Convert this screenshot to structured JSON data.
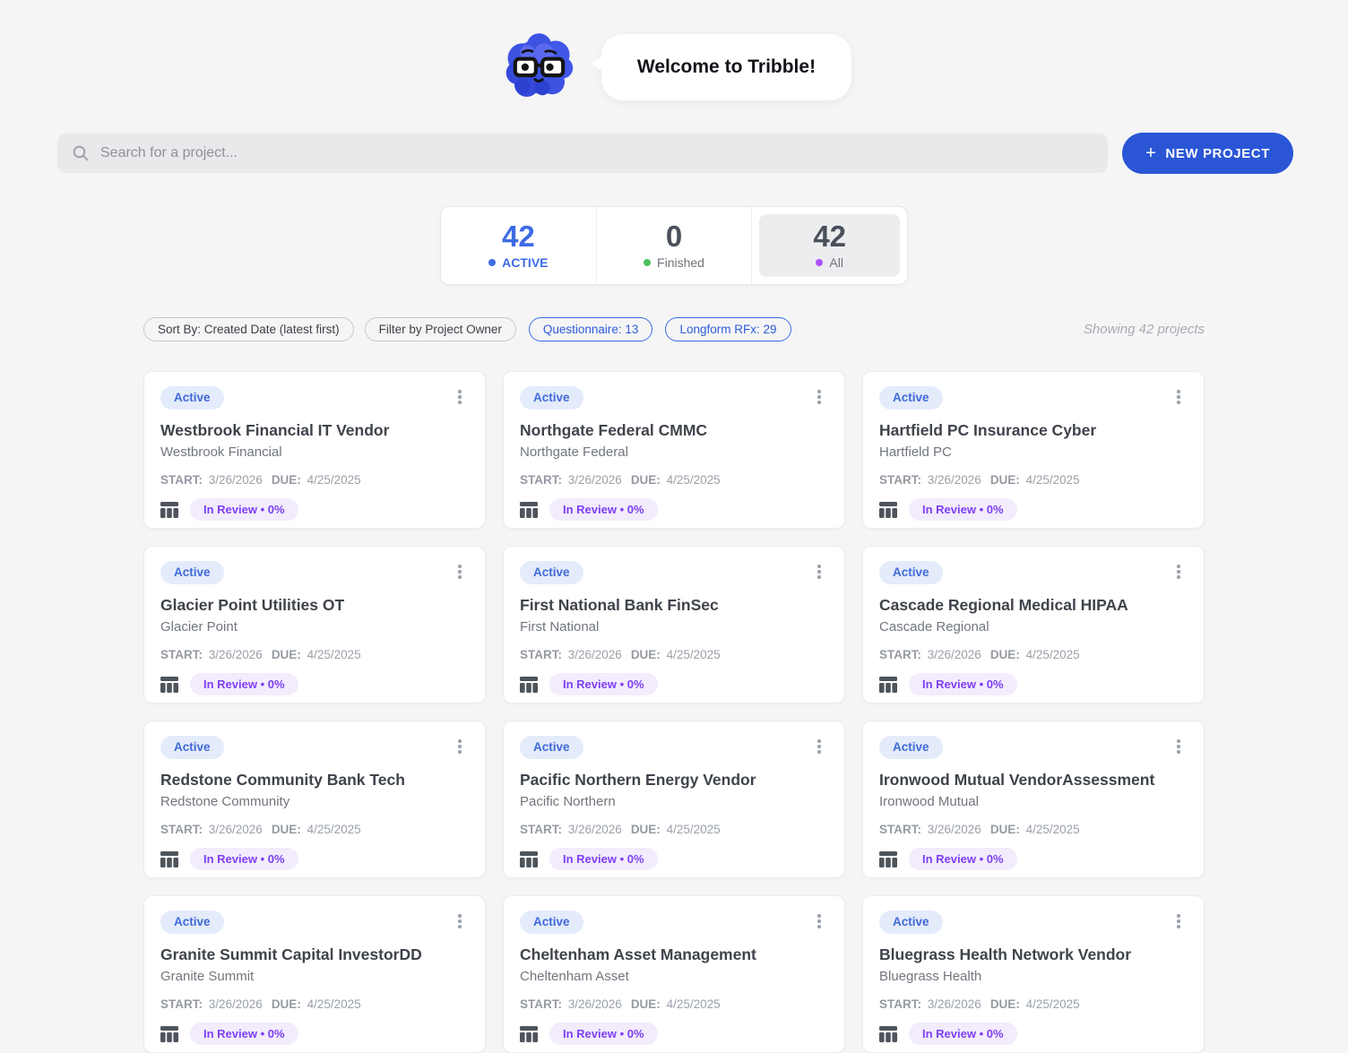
{
  "header": {
    "welcome_text": "Welcome to Tribble!"
  },
  "search": {
    "placeholder": "Search for a project..."
  },
  "toolbar": {
    "new_project_label": "NEW PROJECT",
    "plus_icon": "+"
  },
  "stats": {
    "items": [
      {
        "value": "42",
        "label": "ACTIVE",
        "dot_color": "#3e6be4",
        "highlighted": false
      },
      {
        "value": "0",
        "label": "Finished",
        "dot_color": "#4cc05e",
        "highlighted": false
      },
      {
        "value": "42",
        "label": "All",
        "dot_color": "#ab52f5",
        "highlighted": true
      }
    ]
  },
  "filters": {
    "sort_by": "Sort By: Created Date (latest first)",
    "owner": "Filter by Project Owner",
    "questionnaire": "Questionnaire: 13",
    "longform": "Longform RFx: 29",
    "showing": "Showing 42 projects"
  },
  "card_labels": {
    "start": "START:",
    "due": "DUE:"
  },
  "colors": {
    "accent_blue": "#2a56d6",
    "badge_blue": "#3f6ad8",
    "review_purple": "#7e3ff2",
    "finished_green": "#4cc05e",
    "all_purple": "#ab52f5"
  },
  "projects": [
    {
      "title": "Westbrook Financial IT Vendor",
      "company": "Westbrook Financial",
      "status": "Active",
      "start": "3/26/2026",
      "due": "4/25/2025",
      "review": "In Review • 0%"
    },
    {
      "title": "Northgate Federal CMMC",
      "company": "Northgate Federal",
      "status": "Active",
      "start": "3/26/2026",
      "due": "4/25/2025",
      "review": "In Review • 0%"
    },
    {
      "title": "Hartfield PC Insurance Cyber",
      "company": "Hartfield PC",
      "status": "Active",
      "start": "3/26/2026",
      "due": "4/25/2025",
      "review": "In Review • 0%"
    },
    {
      "title": "Glacier Point Utilities OT",
      "company": "Glacier Point",
      "status": "Active",
      "start": "3/26/2026",
      "due": "4/25/2025",
      "review": "In Review • 0%"
    },
    {
      "title": "First National Bank FinSec",
      "company": "First National",
      "status": "Active",
      "start": "3/26/2026",
      "due": "4/25/2025",
      "review": "In Review • 0%"
    },
    {
      "title": "Cascade Regional Medical HIPAA",
      "company": "Cascade Regional",
      "status": "Active",
      "start": "3/26/2026",
      "due": "4/25/2025",
      "review": "In Review • 0%"
    },
    {
      "title": "Redstone Community Bank Tech",
      "company": "Redstone Community",
      "status": "Active",
      "start": "3/26/2026",
      "due": "4/25/2025",
      "review": "In Review • 0%"
    },
    {
      "title": "Pacific Northern Energy Vendor",
      "company": "Pacific Northern",
      "status": "Active",
      "start": "3/26/2026",
      "due": "4/25/2025",
      "review": "In Review • 0%"
    },
    {
      "title": "Ironwood Mutual VendorAssessment",
      "company": "Ironwood Mutual",
      "status": "Active",
      "start": "3/26/2026",
      "due": "4/25/2025",
      "review": "In Review • 0%"
    },
    {
      "title": "Granite Summit Capital InvestorDD",
      "company": "Granite Summit",
      "status": "Active",
      "start": "3/26/2026",
      "due": "4/25/2025",
      "review": "In Review • 0%"
    },
    {
      "title": "Cheltenham Asset Management",
      "company": "Cheltenham Asset",
      "status": "Active",
      "start": "3/26/2026",
      "due": "4/25/2025",
      "review": "In Review • 0%"
    },
    {
      "title": "Bluegrass Health Network Vendor",
      "company": "Bluegrass Health",
      "status": "Active",
      "start": "3/26/2026",
      "due": "4/25/2025",
      "review": "In Review • 0%"
    }
  ]
}
